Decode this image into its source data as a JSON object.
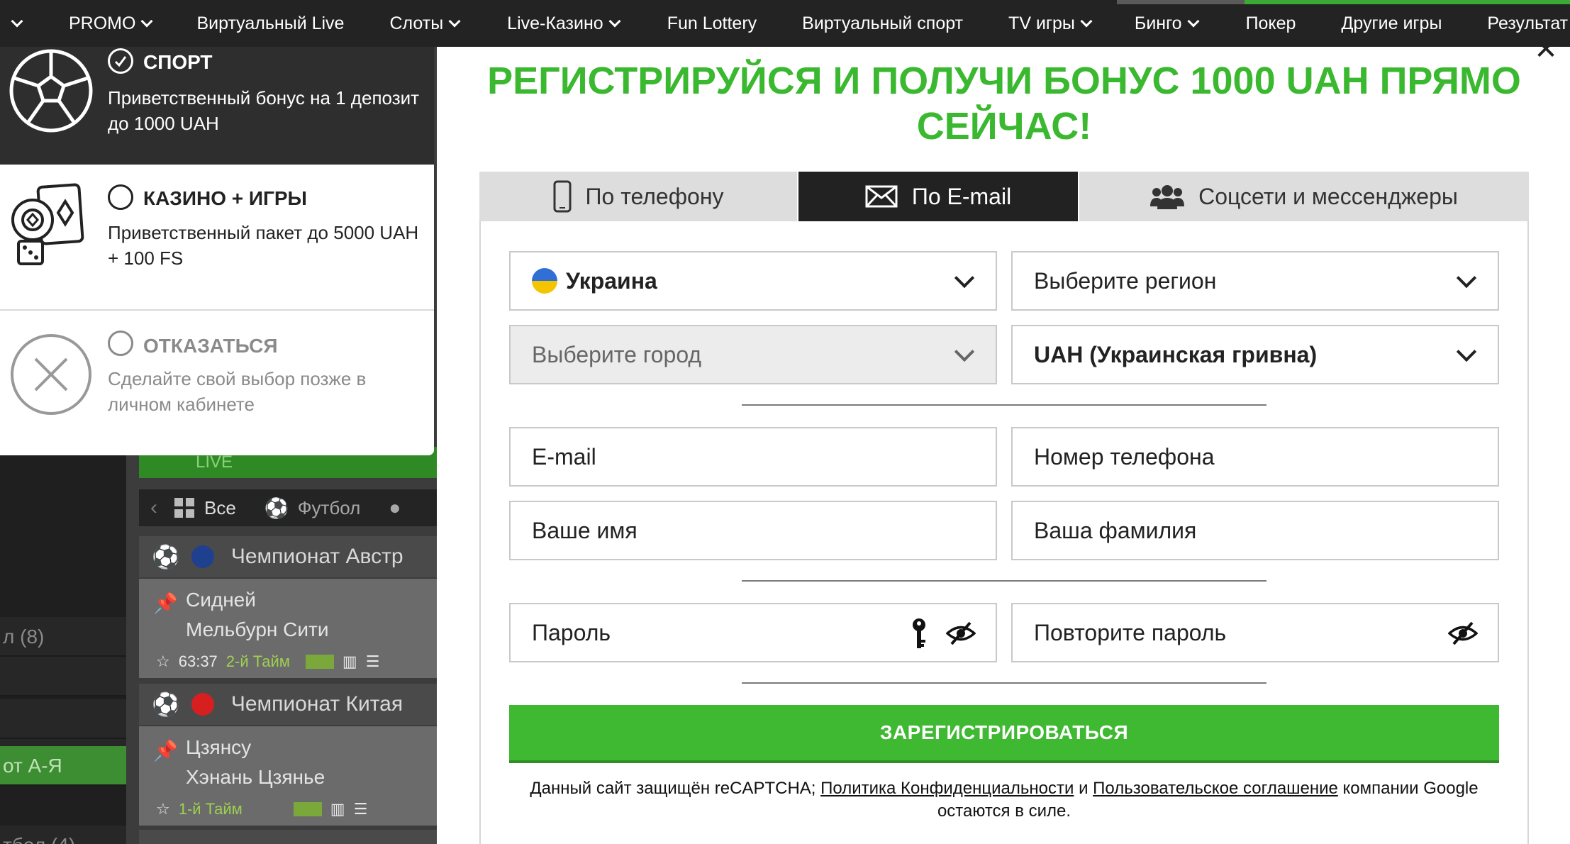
{
  "nav": {
    "items": [
      {
        "label": "PROMO",
        "dropdown": true
      },
      {
        "label": "Виртуальный Live",
        "dropdown": false
      },
      {
        "label": "Слоты",
        "dropdown": true
      },
      {
        "label": "Live-Казино",
        "dropdown": true
      },
      {
        "label": "Fun Lottery",
        "dropdown": false
      },
      {
        "label": "Виртуальный спорт",
        "dropdown": false
      },
      {
        "label": "TV игры",
        "dropdown": true
      },
      {
        "label": "Бинго",
        "dropdown": true
      },
      {
        "label": "Покер",
        "dropdown": false
      },
      {
        "label": "Другие игры",
        "dropdown": false
      },
      {
        "label": "Результат",
        "dropdown": false
      }
    ]
  },
  "background": {
    "left_rows": [
      "л (8)",
      "от А-Я",
      "тбол (4)"
    ],
    "live_label": "LIVE",
    "filter": {
      "all_label": "Все",
      "football_label": "Футбол"
    },
    "leagues": [
      {
        "name": "Чемпионат Австр",
        "flag_color": "#1f3f8f"
      },
      {
        "name": "Чемпионат Китая",
        "flag_color": "#d71f1f"
      }
    ],
    "matches": [
      {
        "team1": "Сидней",
        "team2": "Мельбурн Сити",
        "time": "63:37",
        "period": "2-й Тайм"
      },
      {
        "team1": "Цзянсу",
        "team2": "Хэнань Цзянье",
        "time": "",
        "period": "1-й Тайм"
      }
    ]
  },
  "bonus_panel": {
    "options": [
      {
        "title": "СПОРТ",
        "desc": "Приветственный бонус на 1 депозит до 1000 UAH",
        "selected": true,
        "icon": "soccer-ball-icon"
      },
      {
        "title": "КАЗИНО + ИГРЫ",
        "desc": "Приветственный пакет до 5000 UAH + 100 FS",
        "selected": false,
        "icon": "casino-chips-icon"
      },
      {
        "title": "ОТКАЗАТЬСЯ",
        "desc": "Сделайте свой выбор позже в личном кабинете",
        "selected": false,
        "icon": "decline-x-icon"
      }
    ]
  },
  "registration": {
    "headline_line1": "РЕГИСТРИРУЙСЯ И ПОЛУЧИ БОНУС 1000 UAH ПРЯМО",
    "headline_line2": "СЕЙЧАС!",
    "tabs": [
      {
        "label": "По телефону",
        "icon": "phone-icon",
        "active": false
      },
      {
        "label": "По E-mail",
        "icon": "envelope-icon",
        "active": true
      },
      {
        "label": "Соцсети и мессенджеры",
        "icon": "people-icon",
        "active": false
      }
    ],
    "country": "Украина",
    "region_placeholder": "Выберите регион",
    "city_placeholder": "Выберите город",
    "currency": "UAH (Украинская гривна)",
    "email_placeholder": "E-mail",
    "phone_placeholder": "Номер телефона",
    "first_name_placeholder": "Ваше имя",
    "last_name_placeholder": "Ваша фамилия",
    "password_placeholder": "Пароль",
    "repeat_password_placeholder": "Повторите пароль",
    "submit_label": "ЗАРЕГИСТРИРОВАТЬСЯ",
    "captcha": {
      "prefix": "Данный сайт защищён reCAPTCHA; ",
      "privacy_link": "Политика Конфиденциальности",
      "and": " и ",
      "terms_link": "Пользовательское соглашение",
      "suffix": " компании Google",
      "line2": "остаются в силе."
    }
  },
  "colors": {
    "accent_green": "#3ab82f",
    "button_green": "#3fb832",
    "dark": "#232323"
  }
}
